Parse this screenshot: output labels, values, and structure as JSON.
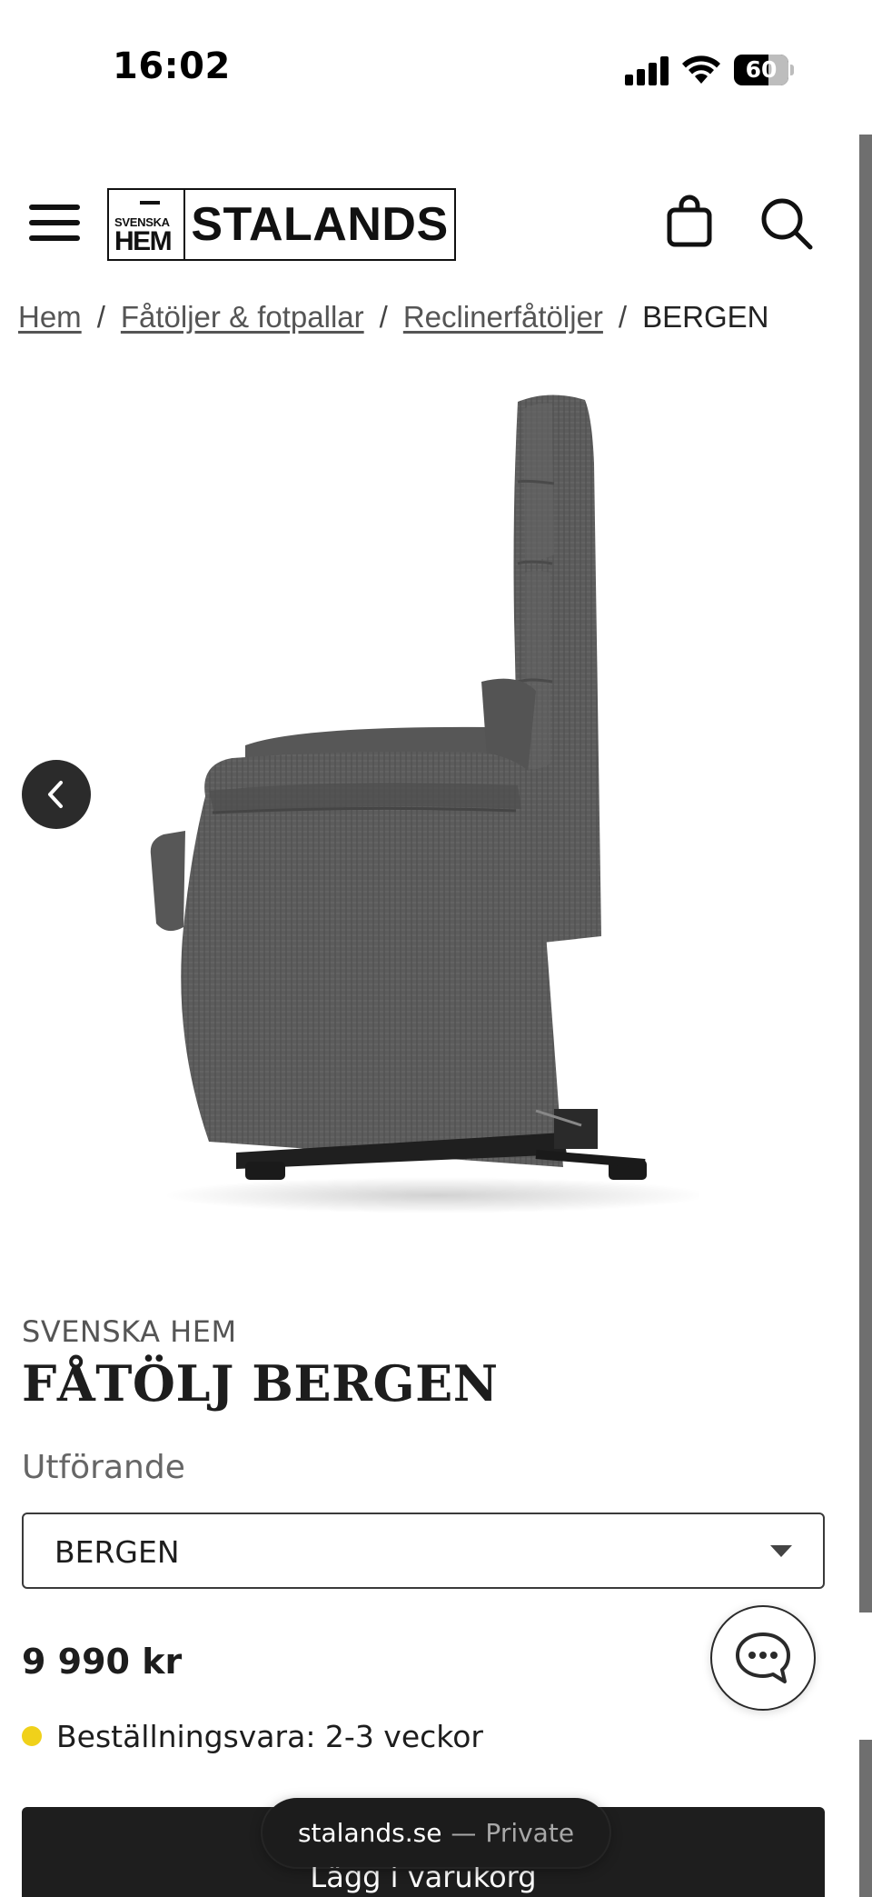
{
  "status_bar": {
    "time": "16:02",
    "battery_level": "60",
    "icons": [
      "signal-icon",
      "wifi-icon",
      "battery-icon"
    ]
  },
  "header": {
    "logo_small": "SVENSKA",
    "logo_hem": "HEM",
    "logo_name": "STALANDS",
    "icons": [
      "menu-icon",
      "shopping-bag-icon",
      "search-icon"
    ]
  },
  "breadcrumb": {
    "items": [
      "Hem",
      "Fåtöljer & fotpallar",
      "Reclinerfåtöljer"
    ],
    "current": "BERGEN",
    "separator": "/"
  },
  "gallery": {
    "image_alt": "Grey fabric recliner armchair, side view",
    "prev_icon": "chevron-left-icon"
  },
  "product": {
    "brand": "SVENSKA HEM",
    "title": "FÅTÖLJ BERGEN",
    "variant_label": "Utförande",
    "variant_value": "BERGEN",
    "price": "9 990 kr",
    "stock_text": "Beställningsvara: 2-3 veckor",
    "stock_color": "#f0d11a"
  },
  "cart": {
    "label": "Lägg i varukorg"
  },
  "chat": {
    "icon": "chat-bubble-icon"
  },
  "browser": {
    "host": "stalands.se",
    "separator": "—",
    "mode": "Private"
  },
  "colors": {
    "text": "#1d1d1d",
    "button_dark": "#1e1e1e",
    "stock_dot": "#f0d11a"
  }
}
